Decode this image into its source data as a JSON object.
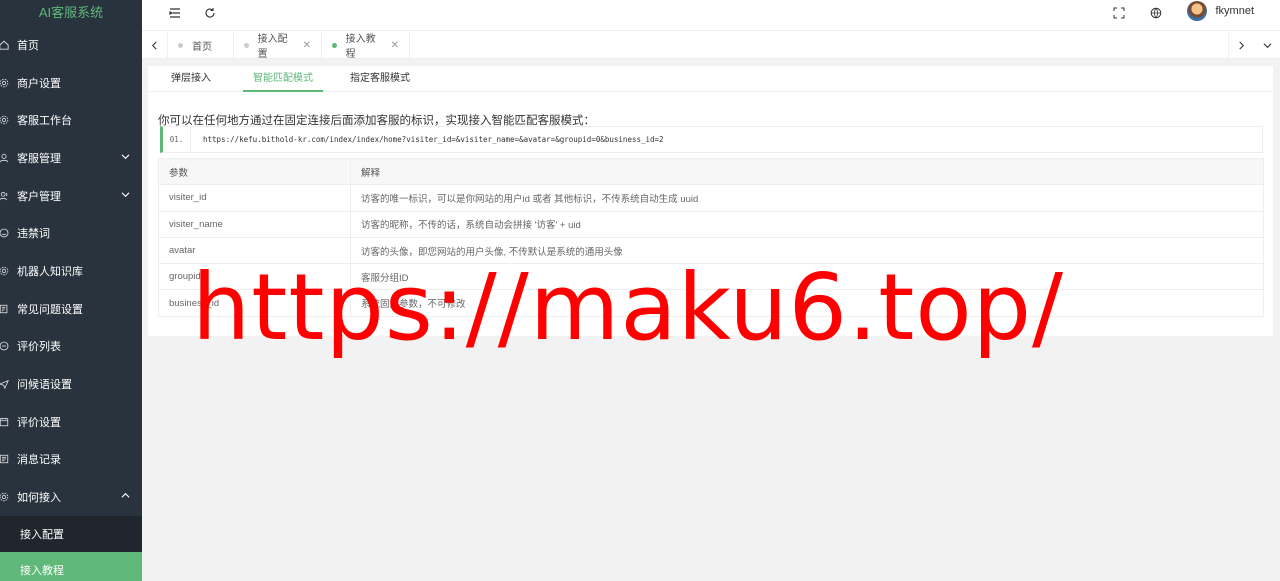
{
  "app": {
    "title": "AI客服系统"
  },
  "sidebar": {
    "items": [
      {
        "label": "首页",
        "icon": "home-icon"
      },
      {
        "label": "商户设置",
        "icon": "gear-icon"
      },
      {
        "label": "客服工作台",
        "icon": "workbench-icon"
      },
      {
        "label": "客服管理",
        "icon": "user-icon",
        "arrow": "down"
      },
      {
        "label": "客户管理",
        "icon": "users-icon",
        "arrow": "down"
      },
      {
        "label": "违禁词",
        "icon": "smile-icon"
      },
      {
        "label": "机器人知识库",
        "icon": "robot-icon"
      },
      {
        "label": "常见问题设置",
        "icon": "faq-icon"
      },
      {
        "label": "评价列表",
        "icon": "comment-icon"
      },
      {
        "label": "问候语设置",
        "icon": "send-icon"
      },
      {
        "label": "评价设置",
        "icon": "calendar-icon"
      },
      {
        "label": "消息记录",
        "icon": "record-icon"
      },
      {
        "label": "如何接入",
        "icon": "plug-icon",
        "arrow": "up"
      }
    ],
    "submenu": [
      {
        "label": "接入配置"
      },
      {
        "label": "接入教程",
        "active": true
      }
    ]
  },
  "header": {
    "username": "fkymnet"
  },
  "tabs": [
    {
      "label": "首页",
      "closable": false
    },
    {
      "label": "接入配置",
      "closable": true
    },
    {
      "label": "接入教程",
      "closable": true,
      "active": true
    }
  ],
  "subtabs": [
    "弹层接入",
    "智能匹配模式",
    "指定客服模式"
  ],
  "intro": "你可以在任何地方通过在固定连接后面添加客服的标识，实现接入智能匹配客服模式：",
  "code": {
    "line": "01.",
    "text": "https://kefu.bithold-kr.com/index/index/home?visiter_id=&visiter_name=&avatar=&groupid=0&business_id=2"
  },
  "params_table": {
    "headers": [
      "参数",
      "解释"
    ],
    "rows": [
      [
        "visiter_id",
        "访客的唯一标识，可以是你网站的用户id 或者 其他标识，不传系统自动生成 uuid"
      ],
      [
        "visiter_name",
        "访客的昵称，不传的话，系统自动会拼接 '访客' + uid"
      ],
      [
        "avatar",
        "访客的头像，即您网站的用户头像, 不传默认是系统的通用头像"
      ],
      [
        "groupid",
        "客服分组ID"
      ],
      [
        "business_id",
        "系统固定参数，不可修改"
      ]
    ]
  },
  "watermark": "https://maku6.top/",
  "colors": {
    "accent": "#5fb878",
    "sidebar": "#28333e",
    "watermark": "#ff0000"
  }
}
